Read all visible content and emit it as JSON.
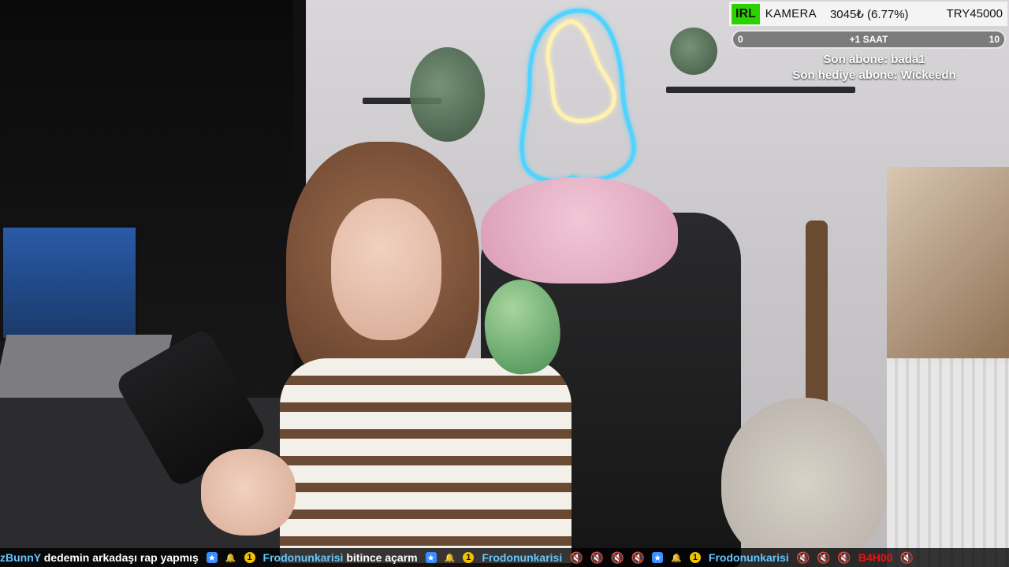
{
  "overlay": {
    "banner": {
      "tag": "IRL",
      "label": "KAMERA",
      "price": "3045₺ (6.77%)",
      "currency": "TRY45000"
    },
    "progress": {
      "left": "0",
      "center": "+1 SAAT",
      "right": "10",
      "fill_fraction": 0.0
    },
    "subs": {
      "line1": "Son abone: bada1",
      "line2": "Son hediye abone: Wickeedn"
    }
  },
  "ticker": {
    "items": [
      {
        "name": "zBunnY",
        "text": " dedemin arkadaşı rap yapmış"
      },
      {
        "name": "Frodonunkarisi",
        "text": " bitince açarm"
      },
      {
        "name": "Frodonunkarisi",
        "text": ""
      },
      {
        "name": "Frodonunkarisi",
        "text": ""
      }
    ],
    "tail_code": "B4H00"
  }
}
